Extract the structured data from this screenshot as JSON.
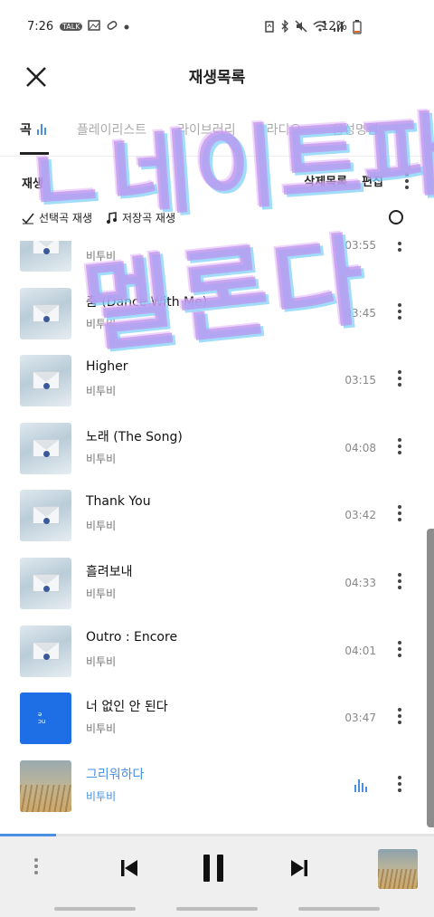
{
  "status_bar": {
    "time": "7:26",
    "left_icons": [
      "TALK",
      "image-icon",
      "pill-icon",
      "dot-icon"
    ],
    "right_icons": [
      "battery-saver-icon",
      "bluetooth-icon",
      "mute-icon",
      "wifi-icon",
      "signal-icon"
    ],
    "battery_percent": "12%"
  },
  "header": {
    "title": "재생목록",
    "close_icon": "close-icon"
  },
  "tabs": [
    {
      "label": "곡",
      "active": true
    },
    {
      "label": "플레이리스트",
      "active": false
    },
    {
      "label": "라이브러리",
      "active": false
    },
    {
      "label": "라디오",
      "active": false
    },
    {
      "label": "음성명령",
      "active": false
    }
  ],
  "toolbar": {
    "left_label": "재생",
    "delete_label": "삭제목록",
    "edit_label": "편집"
  },
  "play_actions": {
    "selected": "선택곡 재생",
    "saved": "저장곡 재생"
  },
  "songs": [
    {
      "title": "Lonely",
      "artist": "비투비",
      "duration": "03:55",
      "art": "envelope"
    },
    {
      "title": "춤 (Dance With Me)",
      "artist": "비투비",
      "duration": "03:45",
      "art": "envelope"
    },
    {
      "title": "Higher",
      "artist": "비투비",
      "duration": "03:15",
      "art": "envelope"
    },
    {
      "title": "노래 (The Song)",
      "artist": "비투비",
      "duration": "04:08",
      "art": "envelope"
    },
    {
      "title": "Thank You",
      "artist": "비투비",
      "duration": "03:42",
      "art": "envelope"
    },
    {
      "title": "흘려보내",
      "artist": "비투비",
      "duration": "04:33",
      "art": "envelope"
    },
    {
      "title": "Outro : Encore",
      "artist": "비투비",
      "duration": "04:01",
      "art": "envelope"
    },
    {
      "title": "너 없인 안 된다",
      "artist": "비투비",
      "duration": "03:47",
      "art": "blue"
    },
    {
      "title": "그리워하다",
      "artist": "비투비",
      "duration": "",
      "art": "field",
      "playing": true
    }
  ],
  "blue_art_text": "ǝ\nɔu",
  "player": {
    "progress": 0.13,
    "prev_icon": "skip-previous-icon",
    "pause_icon": "pause-icon",
    "next_icon": "skip-next-icon"
  },
  "overlay_text": {
    "line1": "ㄴ네이트파",
    "line2": "멜론다"
  },
  "colors": {
    "accent": "#4a90e2",
    "player_bg": "#efefef",
    "overlay": "#ba96ee"
  }
}
